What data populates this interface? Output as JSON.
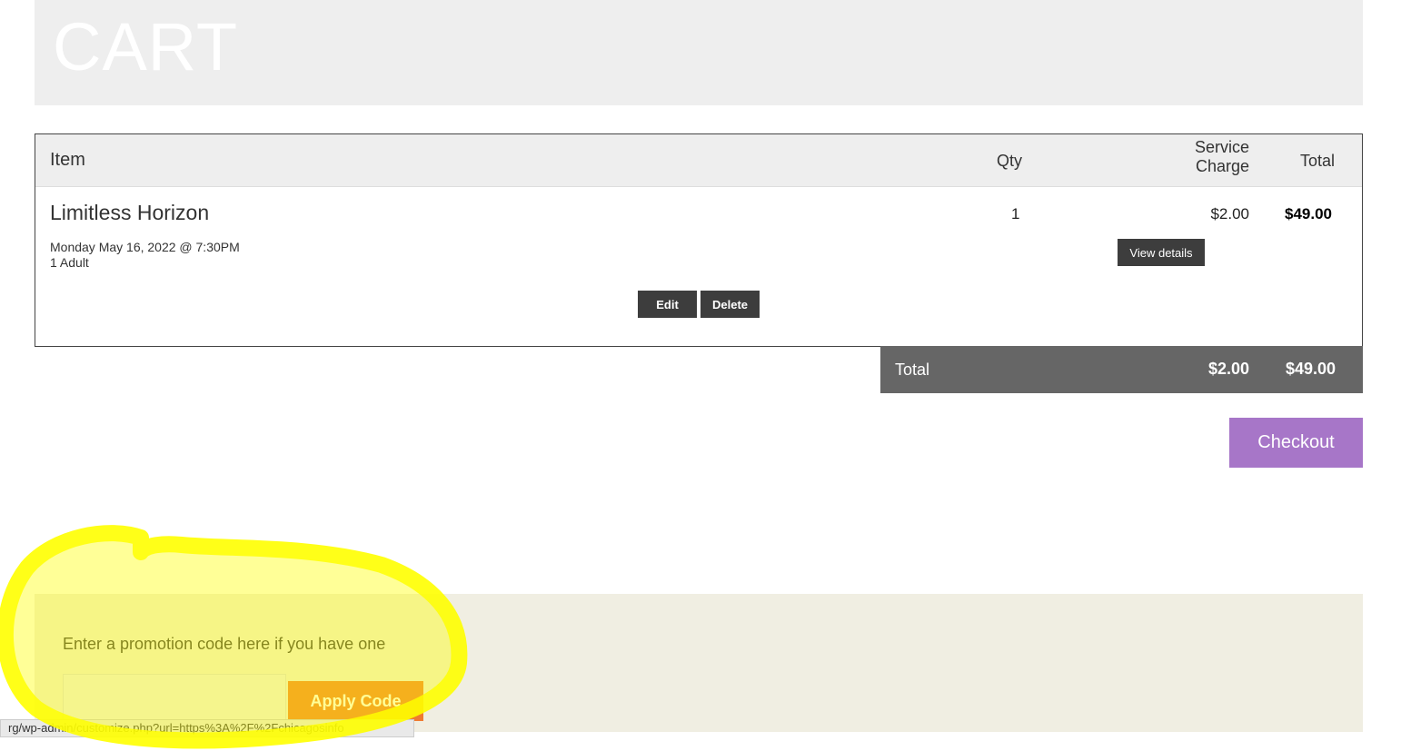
{
  "header": {
    "title": "CART"
  },
  "table": {
    "columns": {
      "item": "Item",
      "qty": "Qty",
      "service_charge": "Service Charge",
      "total": "Total"
    },
    "rows": [
      {
        "name": "Limitless Horizon",
        "date": "Monday May 16, 2022 @ 7:30PM",
        "tickets": "1 Adult",
        "qty": "1",
        "service_charge": "$2.00",
        "total": "$49.00",
        "view_details_label": "View details",
        "edit_label": "Edit",
        "delete_label": "Delete"
      }
    ]
  },
  "totals": {
    "label": "Total",
    "service_charge": "$2.00",
    "total": "$49.00"
  },
  "checkout": {
    "label": "Checkout"
  },
  "promo": {
    "hint": "Enter a promotion code here if you have one",
    "input_value": "",
    "apply_label": "Apply Code"
  },
  "status_bar": {
    "url": "rg/wp-admin/customize.php?url=https%3A%2F%2Fchicagosinfo"
  },
  "colors": {
    "checkout_bg": "#a776c8",
    "apply_bg": "#ef7a31",
    "highlight": "#ffff00",
    "total_bar_bg": "#666666"
  }
}
